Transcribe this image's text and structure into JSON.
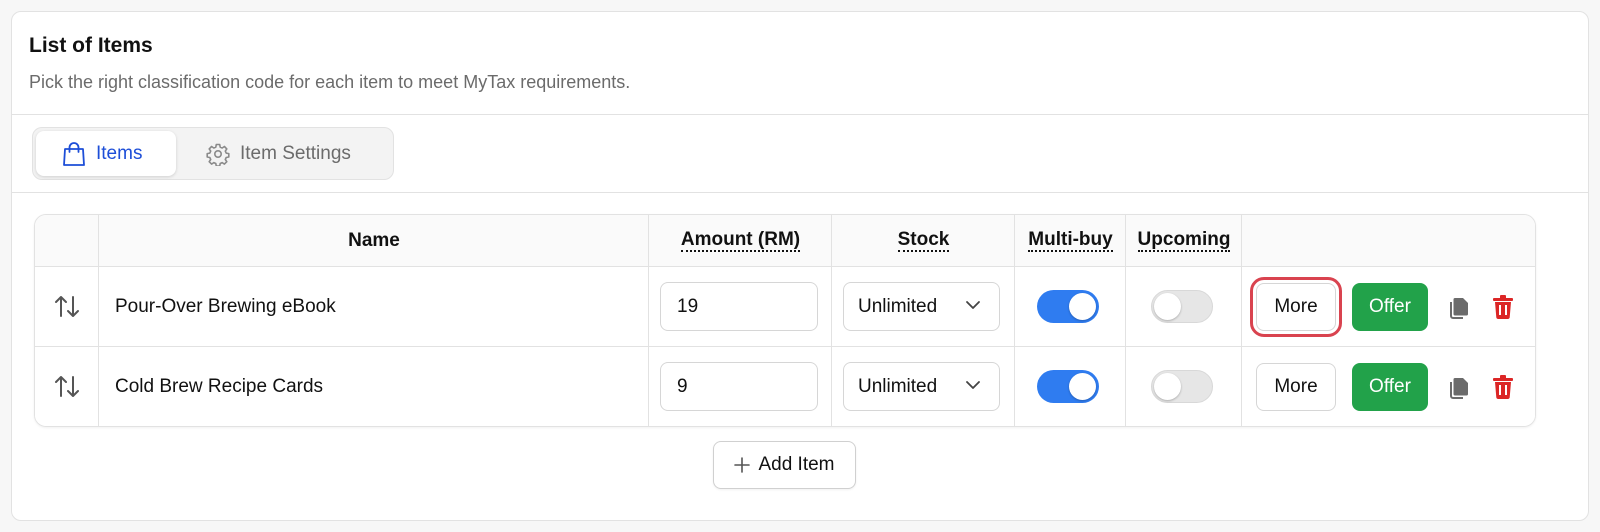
{
  "header": {
    "title": "List of Items",
    "subtitle": "Pick the right classification code for each item to meet MyTax requirements."
  },
  "tabs": [
    {
      "label": "Items",
      "icon": "shopping-bag-icon",
      "active": true
    },
    {
      "label": "Item Settings",
      "icon": "gear-icon",
      "active": false
    }
  ],
  "table": {
    "columns": {
      "name": "Name",
      "amount": "Amount (RM)",
      "stock": "Stock",
      "multibuy": "Multi-buy",
      "upcoming": "Upcoming"
    },
    "rows": [
      {
        "name": "Pour-Over Brewing eBook",
        "amount": "19",
        "stock": "Unlimited",
        "multibuy": true,
        "upcoming": false,
        "more_label": "More",
        "offer_label": "Offer"
      },
      {
        "name": "Cold Brew Recipe Cards",
        "amount": "9",
        "stock": "Unlimited",
        "multibuy": true,
        "upcoming": false,
        "more_label": "More",
        "offer_label": "Offer"
      }
    ]
  },
  "add_item_label": "Add Item",
  "colors": {
    "accent": "#1d4ed8",
    "toggle_on": "#2f7cf0",
    "offer": "#22a24a",
    "danger": "#dc2626",
    "focus_ring": "#d9434f"
  }
}
